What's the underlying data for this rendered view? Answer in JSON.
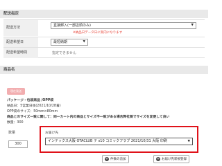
{
  "delivery_section": {
    "title": "配送指定",
    "method": {
      "label": "配送方法",
      "value": "直接郵入(一部店頭のみ)",
      "note": "※納品日データ日に案内になります"
    },
    "date": {
      "label": "配送希望日",
      "value": "最短納期"
    },
    "time": {
      "label": "配送希望時間",
      "value": "指定できません"
    }
  },
  "product_section": {
    "title": "商品名",
    "badge": "現在発送",
    "lines": [
      "パッケージ・包装商品 /OPP袋",
      "納品日：5営業日後(2021/10/28着)",
      "OPP袋のサイズ：50mm×80mm",
      "商品とのサイズ一致に関して：同一カート内の商品とサイズ不一致がある場合弊社側でサイズを変更して良い",
      "数量：300"
    ]
  },
  "order": {
    "qty_label": "数量",
    "qty_value": "300",
    "dest_label": "お届け先",
    "dest_value": "インテックス大阪 OTACLUB テ s10 コミックフラブ 2021/10/31 大阪 印刷"
  },
  "buttons": {
    "add_item": "件数の追加",
    "add_dest": "お届け先新規登録"
  }
}
